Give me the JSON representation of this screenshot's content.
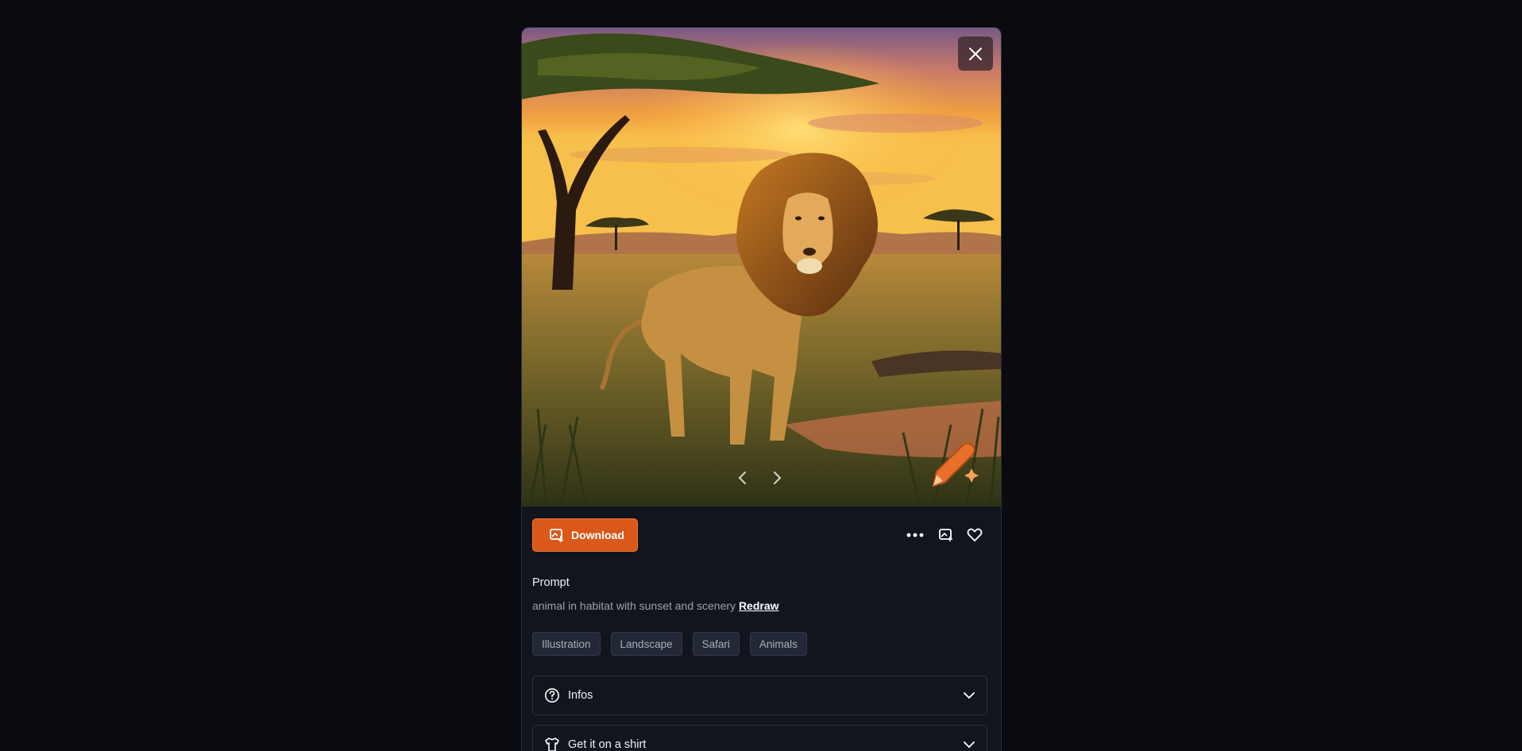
{
  "image": {
    "description_icons": [
      "lion-sunset-scene",
      "pencil-sparkle-watermark-icon"
    ]
  },
  "icons": {
    "close": "close-icon",
    "prev": "chevron-left-icon",
    "next": "chevron-right-icon",
    "download": "image-download-icon",
    "more": "more-dots-icon",
    "image_action": "image-plus-icon",
    "favorite": "heart-icon",
    "infos": "question-circle-icon",
    "shirt": "shirt-icon",
    "expand": "chevron-down-icon"
  },
  "toolbar": {
    "download_label": "Download"
  },
  "prompt": {
    "heading": "Prompt",
    "text": "animal in habitat with sunset and scenery",
    "redraw_label": "Redraw"
  },
  "tags": [
    "Illustration",
    "Landscape",
    "Safari",
    "Animals"
  ],
  "accordions": {
    "infos_label": "Infos",
    "shirt_label": "Get it on a shirt"
  },
  "colors": {
    "accent": "#d9581a",
    "background": "#090b10",
    "panel": "#12151d"
  }
}
